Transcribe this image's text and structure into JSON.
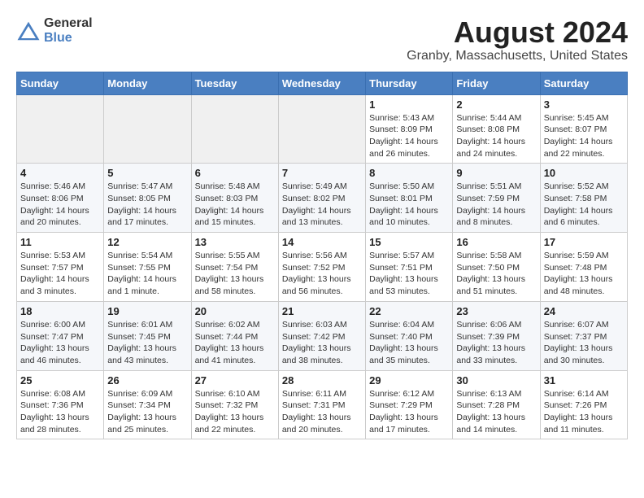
{
  "logo": {
    "general": "General",
    "blue": "Blue"
  },
  "title": "August 2024",
  "subtitle": "Granby, Massachusetts, United States",
  "days_of_week": [
    "Sunday",
    "Monday",
    "Tuesday",
    "Wednesday",
    "Thursday",
    "Friday",
    "Saturday"
  ],
  "weeks": [
    [
      {
        "day": "",
        "info": ""
      },
      {
        "day": "",
        "info": ""
      },
      {
        "day": "",
        "info": ""
      },
      {
        "day": "",
        "info": ""
      },
      {
        "day": "1",
        "info": "Sunrise: 5:43 AM\nSunset: 8:09 PM\nDaylight: 14 hours and 26 minutes."
      },
      {
        "day": "2",
        "info": "Sunrise: 5:44 AM\nSunset: 8:08 PM\nDaylight: 14 hours and 24 minutes."
      },
      {
        "day": "3",
        "info": "Sunrise: 5:45 AM\nSunset: 8:07 PM\nDaylight: 14 hours and 22 minutes."
      }
    ],
    [
      {
        "day": "4",
        "info": "Sunrise: 5:46 AM\nSunset: 8:06 PM\nDaylight: 14 hours and 20 minutes."
      },
      {
        "day": "5",
        "info": "Sunrise: 5:47 AM\nSunset: 8:05 PM\nDaylight: 14 hours and 17 minutes."
      },
      {
        "day": "6",
        "info": "Sunrise: 5:48 AM\nSunset: 8:03 PM\nDaylight: 14 hours and 15 minutes."
      },
      {
        "day": "7",
        "info": "Sunrise: 5:49 AM\nSunset: 8:02 PM\nDaylight: 14 hours and 13 minutes."
      },
      {
        "day": "8",
        "info": "Sunrise: 5:50 AM\nSunset: 8:01 PM\nDaylight: 14 hours and 10 minutes."
      },
      {
        "day": "9",
        "info": "Sunrise: 5:51 AM\nSunset: 7:59 PM\nDaylight: 14 hours and 8 minutes."
      },
      {
        "day": "10",
        "info": "Sunrise: 5:52 AM\nSunset: 7:58 PM\nDaylight: 14 hours and 6 minutes."
      }
    ],
    [
      {
        "day": "11",
        "info": "Sunrise: 5:53 AM\nSunset: 7:57 PM\nDaylight: 14 hours and 3 minutes."
      },
      {
        "day": "12",
        "info": "Sunrise: 5:54 AM\nSunset: 7:55 PM\nDaylight: 14 hours and 1 minute."
      },
      {
        "day": "13",
        "info": "Sunrise: 5:55 AM\nSunset: 7:54 PM\nDaylight: 13 hours and 58 minutes."
      },
      {
        "day": "14",
        "info": "Sunrise: 5:56 AM\nSunset: 7:52 PM\nDaylight: 13 hours and 56 minutes."
      },
      {
        "day": "15",
        "info": "Sunrise: 5:57 AM\nSunset: 7:51 PM\nDaylight: 13 hours and 53 minutes."
      },
      {
        "day": "16",
        "info": "Sunrise: 5:58 AM\nSunset: 7:50 PM\nDaylight: 13 hours and 51 minutes."
      },
      {
        "day": "17",
        "info": "Sunrise: 5:59 AM\nSunset: 7:48 PM\nDaylight: 13 hours and 48 minutes."
      }
    ],
    [
      {
        "day": "18",
        "info": "Sunrise: 6:00 AM\nSunset: 7:47 PM\nDaylight: 13 hours and 46 minutes."
      },
      {
        "day": "19",
        "info": "Sunrise: 6:01 AM\nSunset: 7:45 PM\nDaylight: 13 hours and 43 minutes."
      },
      {
        "day": "20",
        "info": "Sunrise: 6:02 AM\nSunset: 7:44 PM\nDaylight: 13 hours and 41 minutes."
      },
      {
        "day": "21",
        "info": "Sunrise: 6:03 AM\nSunset: 7:42 PM\nDaylight: 13 hours and 38 minutes."
      },
      {
        "day": "22",
        "info": "Sunrise: 6:04 AM\nSunset: 7:40 PM\nDaylight: 13 hours and 35 minutes."
      },
      {
        "day": "23",
        "info": "Sunrise: 6:06 AM\nSunset: 7:39 PM\nDaylight: 13 hours and 33 minutes."
      },
      {
        "day": "24",
        "info": "Sunrise: 6:07 AM\nSunset: 7:37 PM\nDaylight: 13 hours and 30 minutes."
      }
    ],
    [
      {
        "day": "25",
        "info": "Sunrise: 6:08 AM\nSunset: 7:36 PM\nDaylight: 13 hours and 28 minutes."
      },
      {
        "day": "26",
        "info": "Sunrise: 6:09 AM\nSunset: 7:34 PM\nDaylight: 13 hours and 25 minutes."
      },
      {
        "day": "27",
        "info": "Sunrise: 6:10 AM\nSunset: 7:32 PM\nDaylight: 13 hours and 22 minutes."
      },
      {
        "day": "28",
        "info": "Sunrise: 6:11 AM\nSunset: 7:31 PM\nDaylight: 13 hours and 20 minutes."
      },
      {
        "day": "29",
        "info": "Sunrise: 6:12 AM\nSunset: 7:29 PM\nDaylight: 13 hours and 17 minutes."
      },
      {
        "day": "30",
        "info": "Sunrise: 6:13 AM\nSunset: 7:28 PM\nDaylight: 13 hours and 14 minutes."
      },
      {
        "day": "31",
        "info": "Sunrise: 6:14 AM\nSunset: 7:26 PM\nDaylight: 13 hours and 11 minutes."
      }
    ]
  ]
}
